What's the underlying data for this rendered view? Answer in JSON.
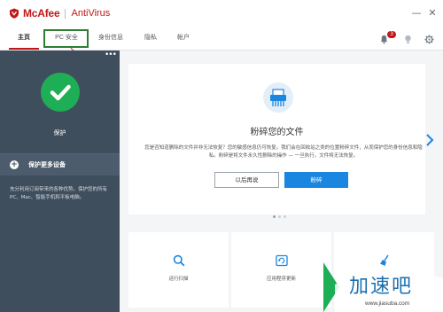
{
  "app": {
    "brand": "McAfee",
    "product": "AntiVirus"
  },
  "window": {
    "min_glyph": "—",
    "close_glyph": "✕"
  },
  "tabs": [
    {
      "label": "主页",
      "active": true
    },
    {
      "label": "PC 安全",
      "active": false
    },
    {
      "label": "身份信息",
      "active": false
    },
    {
      "label": "隐私",
      "active": false
    },
    {
      "label": "帐户",
      "active": false
    }
  ],
  "header_icons": {
    "notification_count": "3",
    "icons": [
      "bell-icon",
      "lightbulb-icon",
      "gear-icon"
    ]
  },
  "sidebar": {
    "menu_dots": "•••",
    "status_label": "保护",
    "add_devices_label": "保护更多设备",
    "description": "充分利用订阅带来的各种优势。保护您的所有 PC、Mac、智能手机和平板电脑。"
  },
  "feature_card": {
    "icon": "shredder-icon",
    "title": "粉碎您的文件",
    "description": "您是否知道删除的文件并非无法恢复？您的敏感信息仍可恢复。我们会在回收站之类的位置粉碎文件，从而保护您的身份信息和隐私。粉碎是将文件永久性删除的操作 — 一旦执行，文件将无法恢复。",
    "later_button": "以后再说",
    "shred_button": "粉碎",
    "page_count": 3,
    "active_page": 0
  },
  "tiles": [
    {
      "icon": "search-icon",
      "label": "运行扫描"
    },
    {
      "icon": "app-update-icon",
      "label": "应用程序更新"
    },
    {
      "icon": "broom-icon",
      "label": ""
    }
  ],
  "watermark": {
    "text": "加速吧",
    "url": "www.jiasuba.com"
  },
  "colors": {
    "brand_red": "#c01818",
    "sidebar_bg": "#3f4e5d",
    "success_green": "#1eae55",
    "primary_blue": "#1b86e0",
    "highlight_box": "#2e7d32"
  }
}
